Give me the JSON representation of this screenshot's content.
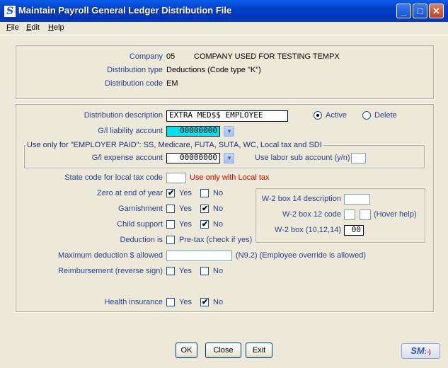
{
  "window": {
    "title": "Maintain Payroll General Ledger Distribution File",
    "icon": "S"
  },
  "menu": {
    "file": "File",
    "edit": "Edit",
    "help": "Help",
    "file_u": "F",
    "file_rest": "ile",
    "edit_u": "E",
    "edit_rest": "dit",
    "help_u": "H",
    "help_rest": "elp"
  },
  "header": {
    "company_label": "Company",
    "company_code": "05",
    "company_name": "COMPANY USED FOR TESTING TEMPX",
    "dist_type_label": "Distribution type",
    "dist_type_value": "Deductions (Code type \"K\")",
    "dist_code_label": "Distribution code",
    "dist_code_value": "EM"
  },
  "form": {
    "desc_label": "Distribution description",
    "desc_value": "EXTRA MED$$ EMPLOYEE",
    "active_label": "Active",
    "delete_label": "Delete",
    "gl_liability_label": "G/l liability account",
    "gl_liability_value": "00000000",
    "employer_paid_note": "Use only for \"EMPLOYER PAID\":  SS, Medicare, FUTA, SUTA, WC, Local tax and SDI",
    "gl_expense_label": "G/l expense account",
    "gl_expense_value": "00000000",
    "labor_sub_label": "Use labor sub account (y/n)",
    "labor_sub_value": "",
    "state_code_label": "State code for local tax code",
    "state_code_value": "",
    "state_code_note": "Use only with Local tax",
    "zero_eoy_label": "Zero at end of year",
    "garnishment_label": "Garnishment",
    "child_support_label": "Child support",
    "deduction_is_label": "Deduction is",
    "pretax_label": "Pre-tax (check if yes)",
    "max_ded_label": "Maximum deduction $ allowed",
    "max_ded_value": "",
    "max_ded_note": "(N9.2) (Employee override is allowed)",
    "reimb_label": "Reimbursement (reverse sign)",
    "health_label": "Health insurance",
    "yes": "Yes",
    "no": "No",
    "w2_14_label": "W-2 box 14 description",
    "w2_14_value": "",
    "w2_12_label": "W-2 box 12 code",
    "w2_12_hover": "(Hover help)",
    "w2_box_label": "W-2 box (10,12,14)",
    "w2_box_value": "00"
  },
  "buttons": {
    "ok": "OK",
    "close": "Close",
    "exit": "Exit",
    "logo": "SM"
  },
  "colors": {
    "titlebar": "#0040c8",
    "label": "#2a3f8f",
    "note_red": "#d40000",
    "highlight": "#00e0f0",
    "check": "#21a121"
  }
}
